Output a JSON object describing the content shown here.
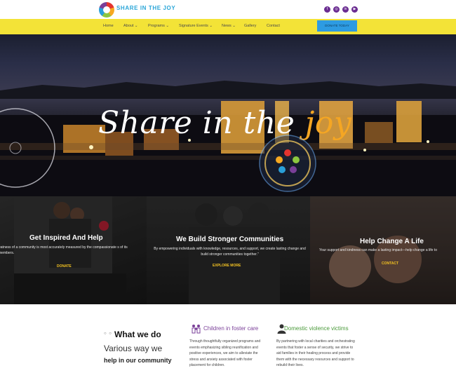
{
  "header": {
    "brand_name": "SHARE IN THE JOY",
    "tagline": "",
    "social_icons": [
      "facebook-icon",
      "instagram-icon",
      "linkedin-icon",
      "youtube-icon"
    ]
  },
  "nav": {
    "items": [
      {
        "label": "Home"
      },
      {
        "label": "About ⌄"
      },
      {
        "label": "Programs ⌄"
      },
      {
        "label": "Signature Events ⌄"
      },
      {
        "label": "News ⌄"
      },
      {
        "label": "Gallery"
      },
      {
        "label": "Contact"
      }
    ],
    "donate_label": "DONATE TODAY"
  },
  "hero": {
    "title_main": "Share in the ",
    "title_accent": "joy"
  },
  "panels": [
    {
      "title": "Get Inspired And Help",
      "text": "eatness of a community is most accurately measured by the compassionate s of its members.",
      "link": "DONATE"
    },
    {
      "title": "We Build Stronger Communities",
      "text": "By empowering individuals with knowledge, resources, and support, we create lasting change and build stronger communities together.\"",
      "link": "EXPLORE MORE"
    },
    {
      "title": "Help Change A Life",
      "text": "Your support and kindness can make a lasting impact—help change a life to",
      "link": "CONTACT"
    }
  ],
  "what_we_do": {
    "dots": "○ ○",
    "title": "What we do",
    "subtitle_line1": "Various way we",
    "subtitle_line2": "help in our community",
    "services": [
      {
        "title": "Children in foster care",
        "text": "Through thoughtfully organized programs and events emphasizing sibling reunification and positive experiences, we aim to alleviate the stress and anxiety associated with foster placement for children.",
        "icon": "family-icon"
      },
      {
        "title": "Domestic violence victims",
        "text": "By partnering with local charities and orchestrating events that foster a sense of security, we strive to aid families in their healing process and provide them with the necessary resources and support to rebuild their lives.",
        "icon": "person-icon"
      }
    ]
  },
  "colors": {
    "nav_bg": "#f3e337",
    "donate_bg": "#2d9be2",
    "accent_gold": "#f5a623",
    "link_gold": "#f3c222",
    "brand_blue": "#2aa6d8",
    "social_purple": "#6a2c91",
    "service_purple": "#7a3f98",
    "service_green": "#4a9a3a"
  }
}
